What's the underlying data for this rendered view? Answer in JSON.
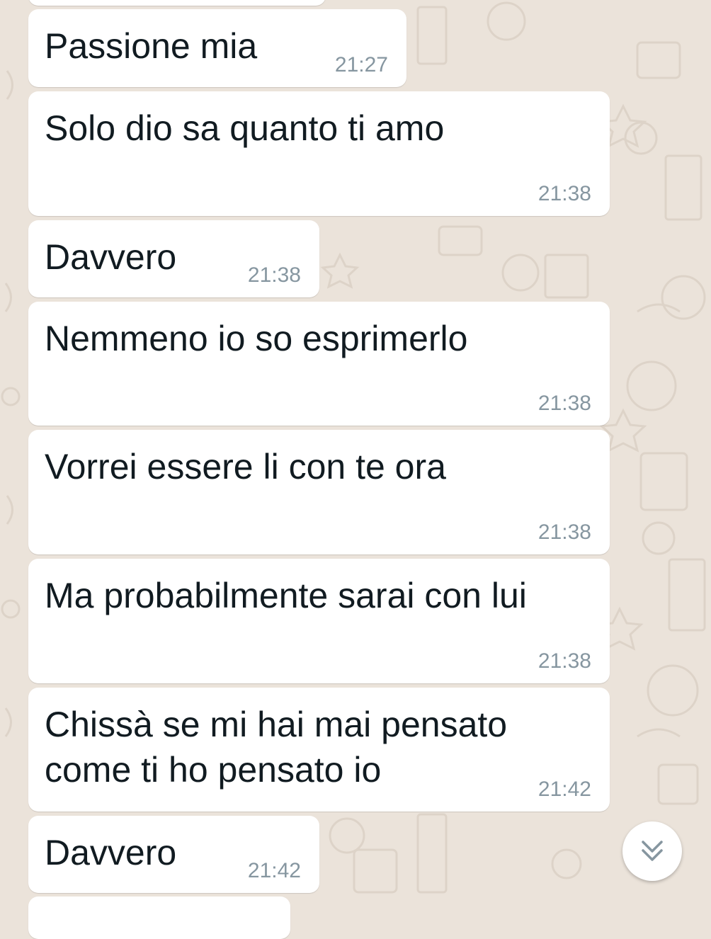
{
  "chat": {
    "messages": [
      {
        "text": "Passione mia",
        "time": "21:27"
      },
      {
        "text": "Solo dio sa quanto ti amo",
        "time": "21:38"
      },
      {
        "text": "Davvero",
        "time": "21:38"
      },
      {
        "text": "Nemmeno io so esprimerlo",
        "time": "21:38"
      },
      {
        "text": "Vorrei essere li con te ora",
        "time": "21:38"
      },
      {
        "text": "Ma probabilmente sarai con lui",
        "time": "21:38"
      },
      {
        "text": "Chissà se mi hai mai pensato\ncome ti ho pensato io",
        "time": "21:42"
      },
      {
        "text": "Davvero",
        "time": "21:42"
      }
    ]
  },
  "scroll_button": {
    "icon": "double-chevron-down-icon"
  },
  "colors": {
    "background": "#ebe3da",
    "bubble": "#ffffff",
    "text": "#111b21",
    "timestamp": "#8696a0"
  }
}
